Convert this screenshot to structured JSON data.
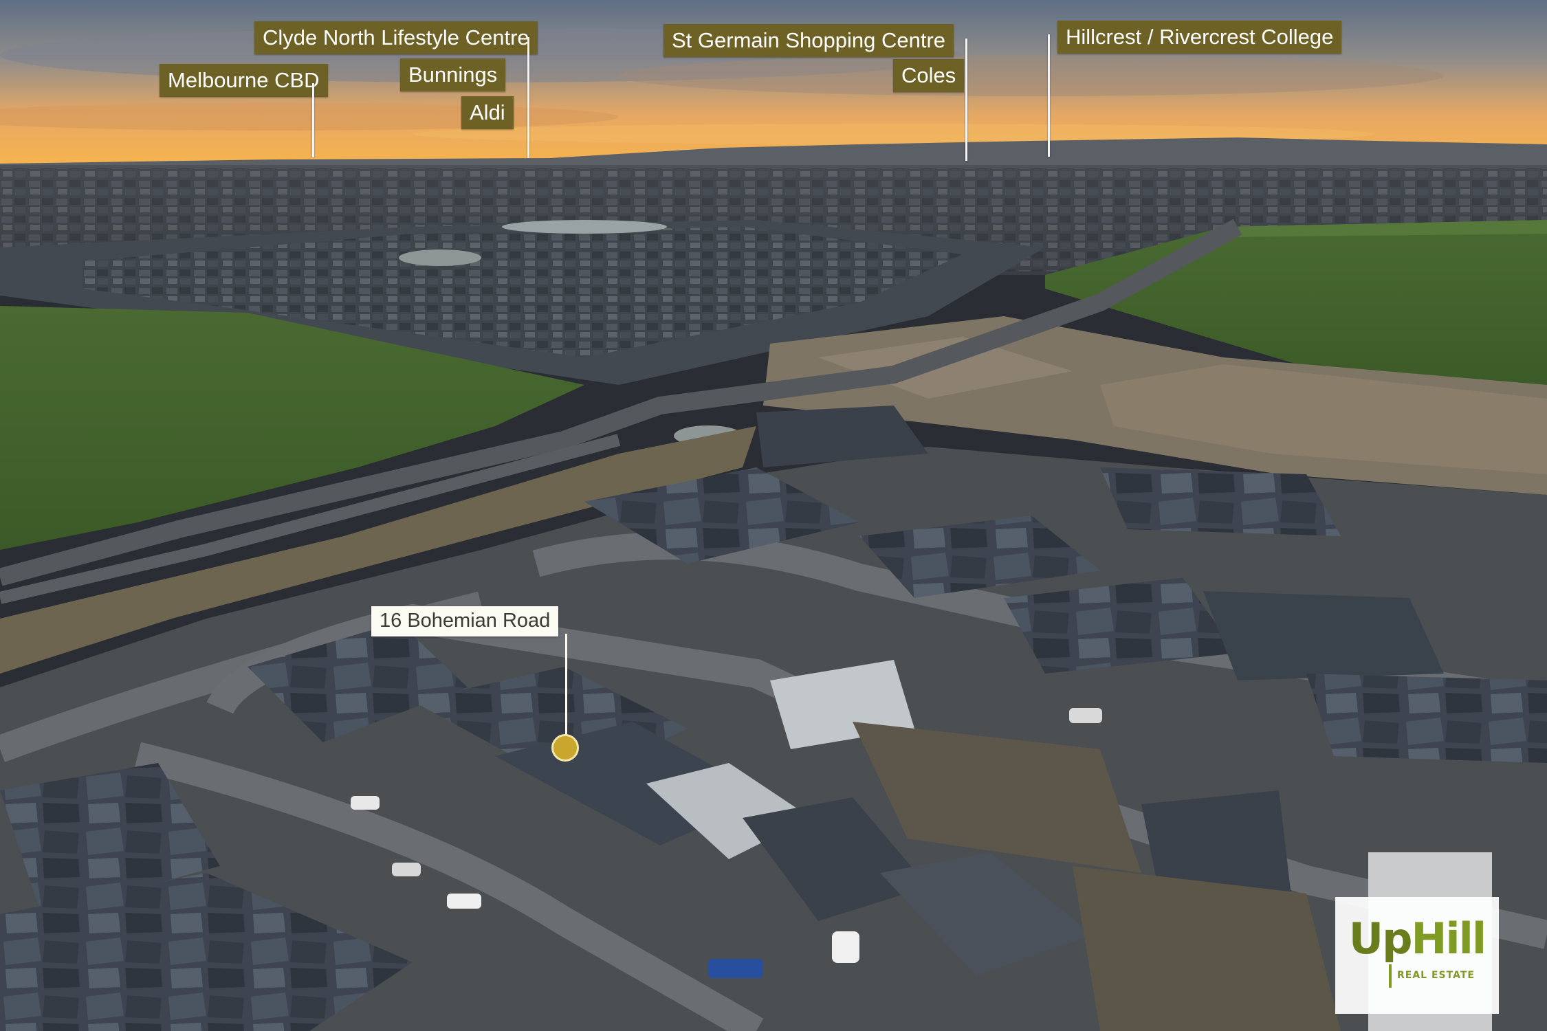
{
  "poi_labels": [
    "Clyde North Lifestyle Centre",
    "Bunnings",
    "Aldi",
    "Melbourne CBD",
    "St Germain Shopping Centre",
    "Coles",
    "Hillcrest / Rivercrest College"
  ],
  "property": {
    "address": "16 Bohemian Road"
  },
  "logo": {
    "word_up": "Up",
    "word_hill": "Hill",
    "subtitle": "REAL ESTATE"
  },
  "colors": {
    "label_background": "#6e6126",
    "label_text": "#ffffff",
    "property_marker": "#c9a62c",
    "logo_green": "#7f9b22"
  }
}
